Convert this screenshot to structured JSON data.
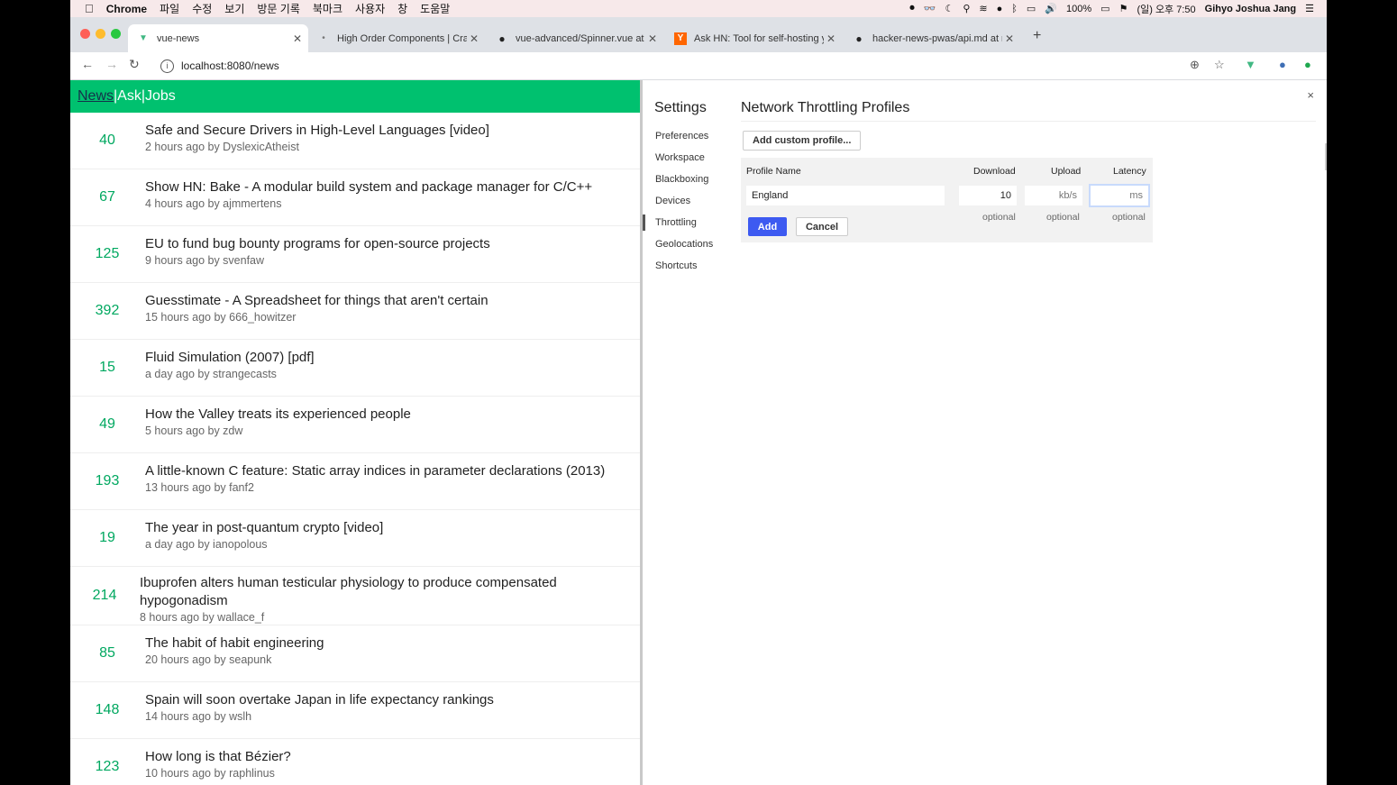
{
  "menubar": {
    "apple_glyph": "",
    "app": "Chrome",
    "items": [
      "파일",
      "수정",
      "보기",
      "방문 기록",
      "북마크",
      "사용자",
      "창",
      "도움말"
    ],
    "battery": "100%",
    "clock": "(일) 오후 7:50",
    "user": "Gihyo Joshua Jang"
  },
  "tabs": [
    {
      "title": "vue-news",
      "favicon": "vue-icon"
    },
    {
      "title": "High Order Components | Crac",
      "favicon": "site-icon"
    },
    {
      "title": "vue-advanced/Spinner.vue at",
      "favicon": "github-icon"
    },
    {
      "title": "Ask HN: Tool for self-hosting y",
      "favicon": "ycombinator-icon"
    },
    {
      "title": "hacker-news-pwas/api.md at n",
      "favicon": "github-icon"
    }
  ],
  "address": {
    "url": "localhost:8080/news"
  },
  "nav": {
    "news": "News",
    "sep": "|",
    "ask": "Ask",
    "jobs": "Jobs"
  },
  "items": [
    {
      "score": "40",
      "title": "Safe and Secure Drivers in High-Level Languages [video]",
      "meta": "2 hours ago by DyslexicAtheist"
    },
    {
      "score": "67",
      "title": "Show HN: Bake - A modular build system and package manager for C/C++",
      "meta": "4 hours ago by ajmmertens"
    },
    {
      "score": "125",
      "title": "EU to fund bug bounty programs for open-source projects",
      "meta": "9 hours ago by svenfaw"
    },
    {
      "score": "392",
      "title": "Guesstimate - A Spreadsheet for things that aren't certain",
      "meta": "15 hours ago by 666_howitzer"
    },
    {
      "score": "15",
      "title": "Fluid Simulation (2007) [pdf]",
      "meta": "a day ago by strangecasts"
    },
    {
      "score": "49",
      "title": "How the Valley treats its experienced people",
      "meta": "5 hours ago by zdw"
    },
    {
      "score": "193",
      "title": "A little-known C feature: Static array indices in parameter declarations (2013)",
      "meta": "13 hours ago by fanf2"
    },
    {
      "score": "19",
      "title": "The year in post-quantum crypto [video]",
      "meta": "a day ago by ianopolous"
    },
    {
      "score": "214",
      "title": "Ibuprofen alters human testicular physiology to produce compensated hypogonadism",
      "meta": "8 hours ago by wallace_f"
    },
    {
      "score": "85",
      "title": "The habit of habit engineering",
      "meta": "20 hours ago by seapunk"
    },
    {
      "score": "148",
      "title": "Spain will soon overtake Japan in life expectancy rankings",
      "meta": "14 hours ago by wslh"
    },
    {
      "score": "123",
      "title": "How long is that Bézier?",
      "meta": "10 hours ago by raphlinus"
    }
  ],
  "devtools": {
    "settings_title": "Settings",
    "sidebar": [
      "Preferences",
      "Workspace",
      "Blackboxing",
      "Devices",
      "Throttling",
      "Geolocations",
      "Shortcuts"
    ],
    "active_section": "Throttling",
    "heading": "Network Throttling Profiles",
    "add_custom_label": "Add custom profile...",
    "columns": {
      "name": "Profile Name",
      "download": "Download",
      "upload": "Upload",
      "latency": "Latency"
    },
    "fields": {
      "name_value": "England",
      "download_value": "10",
      "upload_placeholder": "kb/s",
      "latency_placeholder": "ms"
    },
    "optional_label": "optional",
    "add_label": "Add",
    "cancel_label": "Cancel",
    "close_glyph": "×"
  },
  "colors": {
    "accent": "#00c16f",
    "score": "#00a860",
    "primary_button": "#3d5af1"
  }
}
